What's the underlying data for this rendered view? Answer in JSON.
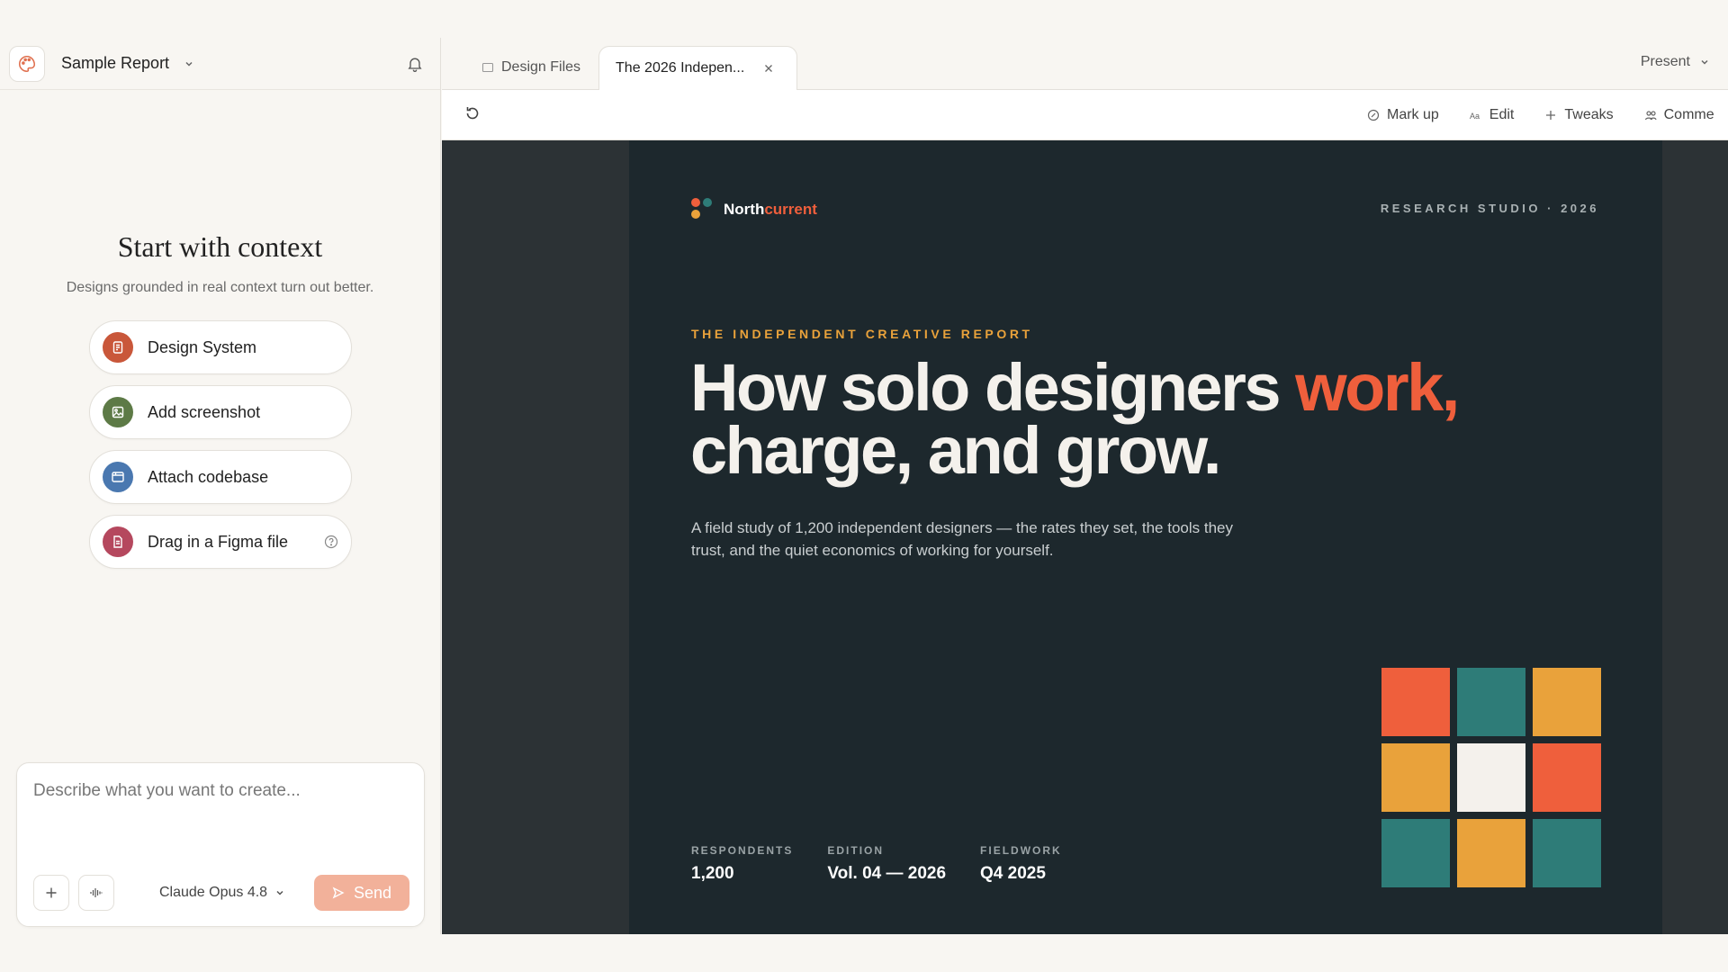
{
  "project": {
    "title": "Sample Report"
  },
  "context": {
    "title": "Start with context",
    "subtitle": "Designs grounded in real context turn out better.",
    "items": [
      {
        "label": "Design System",
        "icon": "design-system-icon",
        "color": "#c9573a"
      },
      {
        "label": "Add screenshot",
        "icon": "image-icon",
        "color": "#5d7a46"
      },
      {
        "label": "Attach codebase",
        "icon": "codebase-icon",
        "color": "#4a78b0"
      },
      {
        "label": "Drag in a Figma file",
        "icon": "figma-file-icon",
        "color": "#b5485e"
      }
    ]
  },
  "composer": {
    "placeholder": "Describe what you want to create...",
    "model": "Claude Opus 4.8",
    "send_label": "Send"
  },
  "tabs": [
    {
      "label": "Design Files",
      "active": false
    },
    {
      "label": "The 2026 Indepen...",
      "active": true
    }
  ],
  "present_label": "Present",
  "toolbar": {
    "markup": "Mark up",
    "edit": "Edit",
    "tweaks": "Tweaks",
    "comments": "Comme"
  },
  "slide": {
    "brand_part1": "North",
    "brand_part2": "current",
    "studio": "RESEARCH STUDIO · 2026",
    "kicker": "THE INDEPENDENT CREATIVE REPORT",
    "headline_1": "How solo designers ",
    "headline_accent": "work,",
    "headline_2": "charge, and grow.",
    "lede": "A field study of 1,200 independent designers — the rates they set, the tools they trust, and the quiet economics of working for yourself.",
    "stats": [
      {
        "label": "RESPONDENTS",
        "value": "1,200"
      },
      {
        "label": "EDITION",
        "value": "Vol. 04 — 2026"
      },
      {
        "label": "FIELDWORK",
        "value": "Q4 2025"
      }
    ],
    "grid_colors": [
      "#ef5f3c",
      "#2e7c78",
      "#e9a23b",
      "#e9a23b",
      "#f4f1ec",
      "#ef5f3c",
      "#2e7c78",
      "#e9a23b",
      "#2e7c78"
    ],
    "colors": {
      "orange": "#ef5f3c",
      "teal": "#2e7c78",
      "amber": "#e9a23b",
      "bg": "#1d282d"
    }
  }
}
